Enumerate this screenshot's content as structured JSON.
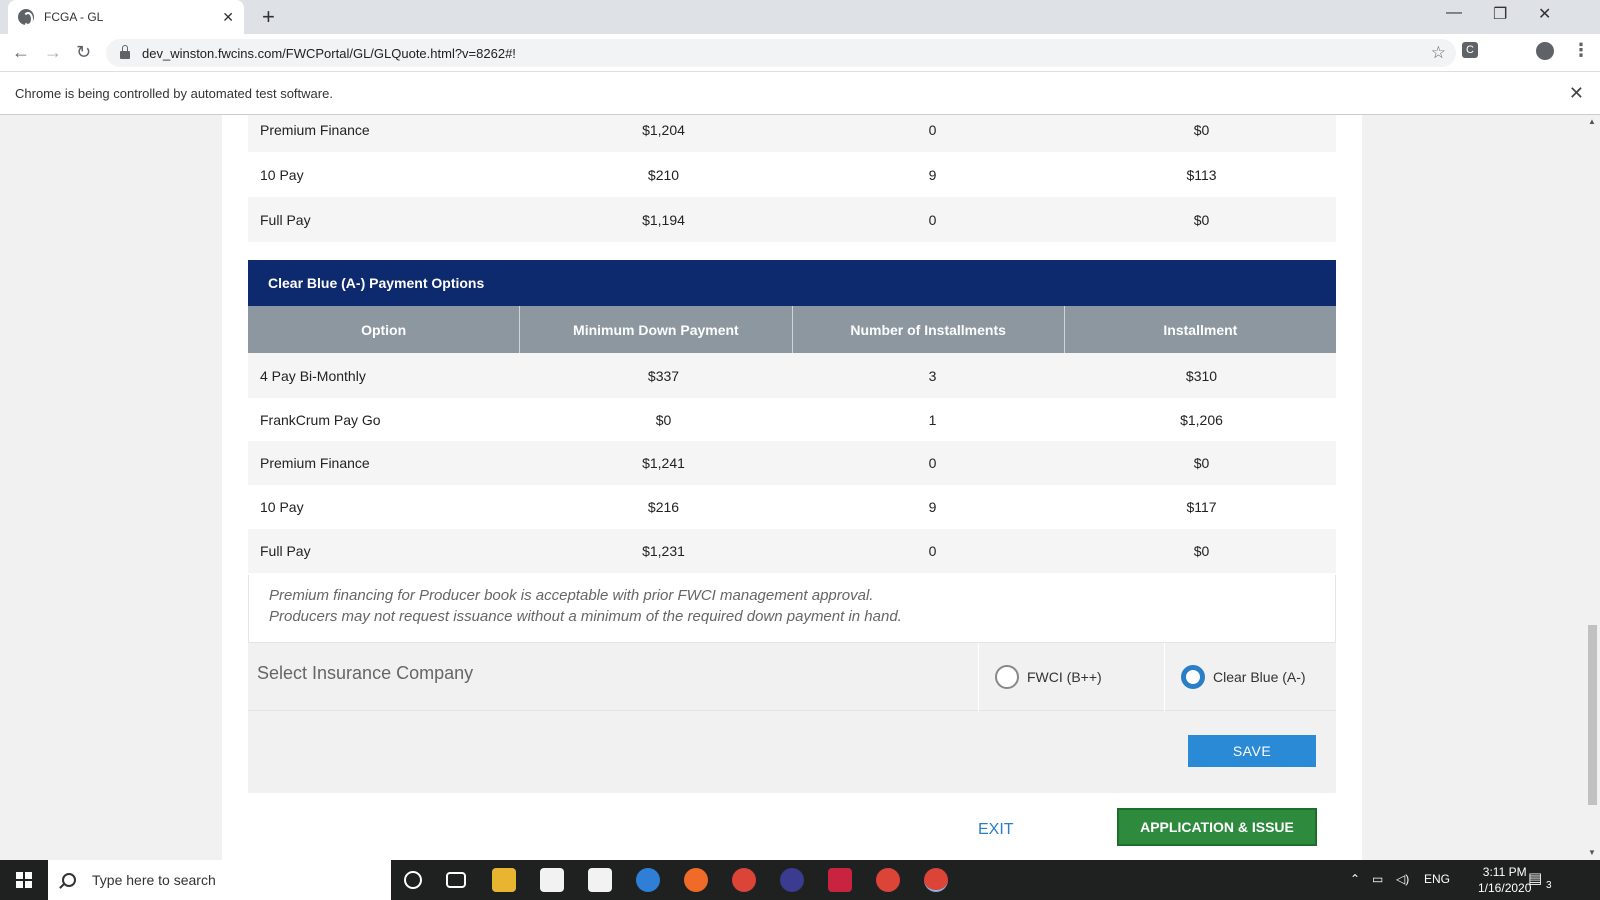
{
  "browser": {
    "tab_title": "FCGA - GL",
    "url": "dev_winston.fwcins.com/FWCPortal/GL/GLQuote.html?v=8262#!",
    "infobar_text": "Chrome is being controlled by automated test software."
  },
  "previous_table": {
    "rows": [
      {
        "option": "Premium Finance",
        "down": "$1,204",
        "installments": "0",
        "installment": "$0"
      },
      {
        "option": "10 Pay",
        "down": "$210",
        "installments": "9",
        "installment": "$113"
      },
      {
        "option": "Full Pay",
        "down": "$1,194",
        "installments": "0",
        "installment": "$0"
      }
    ]
  },
  "clear_blue": {
    "title": "Clear Blue (A-) Payment Options",
    "headers": {
      "option": "Option",
      "down": "Minimum Down Payment",
      "installments": "Number of Installments",
      "installment": "Installment"
    },
    "rows": [
      {
        "option": "4 Pay Bi-Monthly",
        "down": "$337",
        "installments": "3",
        "installment": "$310"
      },
      {
        "option": "FrankCrum Pay Go",
        "down": "$0",
        "installments": "1",
        "installment": "$1,206"
      },
      {
        "option": "Premium Finance",
        "down": "$1,241",
        "installments": "0",
        "installment": "$0"
      },
      {
        "option": "10 Pay",
        "down": "$216",
        "installments": "9",
        "installment": "$117"
      },
      {
        "option": "Full Pay",
        "down": "$1,231",
        "installments": "0",
        "installment": "$0"
      }
    ]
  },
  "note": {
    "line1": "Premium financing for Producer book is acceptable with prior FWCI management approval.",
    "line2": "Producers may not request issuance without a minimum of the required down payment in hand."
  },
  "select_company": {
    "label": "Select Insurance Company",
    "options": [
      {
        "label": "FWCI (B++)",
        "selected": false
      },
      {
        "label": "Clear Blue (A-)",
        "selected": true
      }
    ],
    "save_label": "SAVE"
  },
  "actions": {
    "exit_label": "EXIT",
    "app_issue_label": "APPLICATION & ISSUE"
  },
  "taskbar": {
    "search_placeholder": "Type here to search",
    "lang": "ENG",
    "time": "3:11 PM",
    "date": "1/16/2020",
    "notification_count": "3"
  },
  "colors": {
    "header_navy": "#0e2a6e",
    "column_header_gray": "#8c979f",
    "save_blue": "#2a8ad6",
    "app_green": "#2e8b3e",
    "radio_selected": "#2a7ec8"
  }
}
